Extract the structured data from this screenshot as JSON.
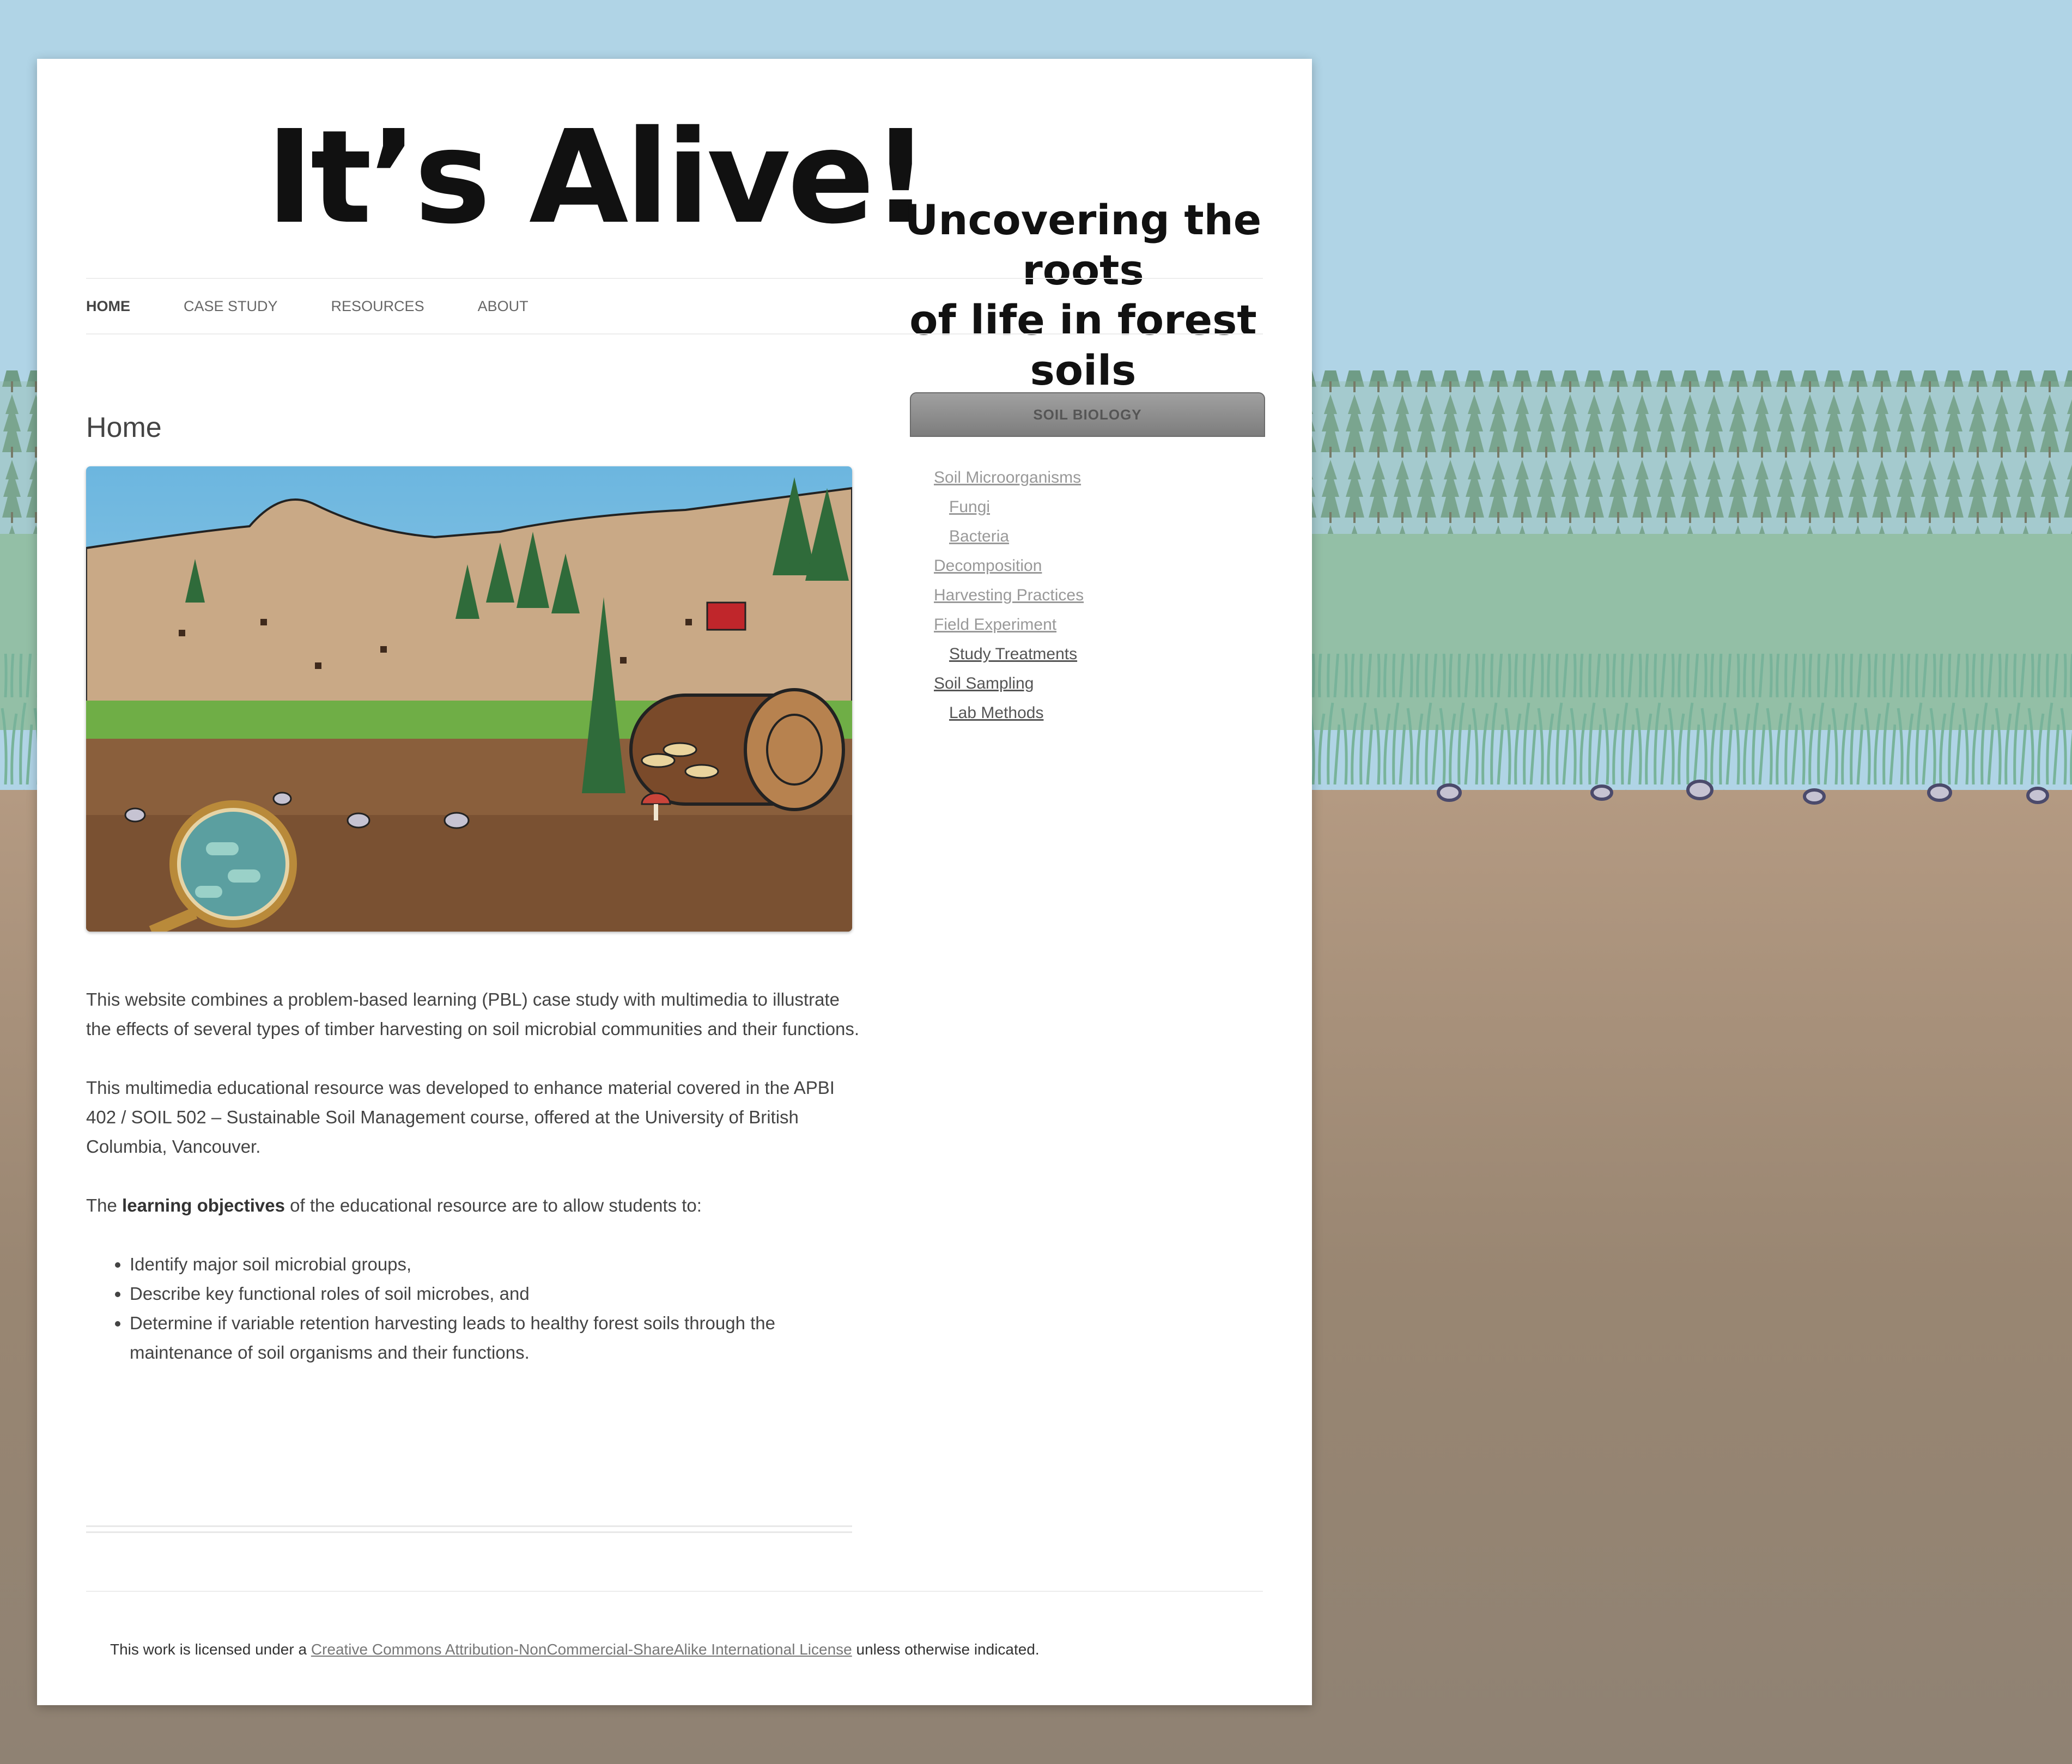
{
  "site": {
    "banner_title": "It’s Alive!",
    "banner_subtitle_line1": "Uncovering the roots",
    "banner_subtitle_line2": "of life in forest soils"
  },
  "nav": {
    "items": [
      {
        "label": "HOME",
        "active": true
      },
      {
        "label": "CASE STUDY"
      },
      {
        "label": "RESOURCES"
      },
      {
        "label": "ABOUT"
      }
    ]
  },
  "main": {
    "page_title": "Home",
    "paragraph1": "This website combines a problem-based learning (PBL) case study with multimedia to illustrate the effects of several types of timber harvesting on soil microbial communities and their functions.",
    "paragraph2": "This multimedia educational resource was developed to enhance material covered in the APBI 402 / SOIL 502 – Sustainable Soil Management course, offered at the University of British Columbia, Vancouver.",
    "paragraph3_prefix": "The ",
    "paragraph3_bold": "learning objectives",
    "paragraph3_suffix": " of the educational resource are to allow students to:",
    "objectives": [
      "Identify major soil microbial groups,",
      "Describe key functional roles of soil microbes, and",
      "Determine if variable retention harvesting leads to healthy forest soils through the maintenance of soil organisms and their functions."
    ]
  },
  "sidebar": {
    "widget_title": "SOIL BIOLOGY",
    "items": [
      {
        "label": "Soil Microorganisms"
      },
      {
        "label": "Fungi"
      },
      {
        "label": "Bacteria"
      },
      {
        "label": "Decomposition"
      },
      {
        "label": "Harvesting Practices"
      },
      {
        "label": "Field Experiment"
      },
      {
        "label": "Study Treatments"
      },
      {
        "label": "Soil Sampling"
      },
      {
        "label": "Lab Methods"
      }
    ]
  },
  "footer": {
    "prefix": "This work is licensed under a ",
    "link": "Creative Commons Attribution-NonCommercial-ShareAlike International License",
    "suffix": " unless otherwise indicated."
  },
  "colors": {
    "sky": "#b0d4e6",
    "soil": "#8f8273",
    "grass": "#7fb08a",
    "widget_header": "#8a8a8a"
  }
}
